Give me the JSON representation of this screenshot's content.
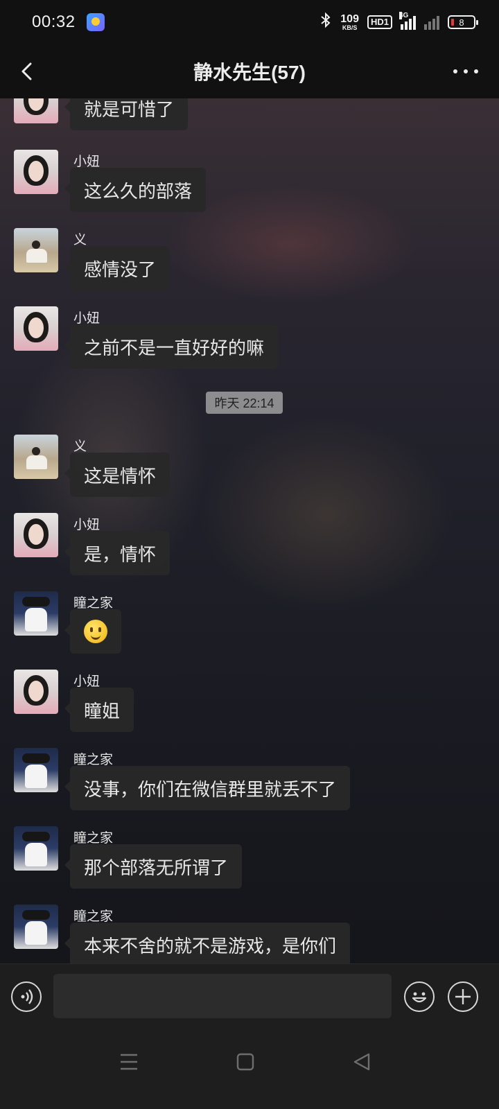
{
  "status_bar": {
    "time": "00:32",
    "speed_value": "109",
    "speed_unit": "KB/S",
    "hd_label": "HD1",
    "network_label": "4G",
    "battery_level": "8",
    "battery_low_color": "#e23b3b",
    "icons": [
      "app-notification-icon",
      "bluetooth-icon",
      "signal-icon",
      "signal-icon",
      "battery-icon"
    ]
  },
  "header": {
    "title": "静水先生(57)",
    "back_icon": "back-chevron-icon",
    "more_icon": "more-dots-icon"
  },
  "messages": [
    {
      "sender": "",
      "avatar": "girl",
      "text": "就是可惜了"
    },
    {
      "sender": "小妞",
      "avatar": "girl",
      "text": "这么久的部落"
    },
    {
      "sender": "义",
      "avatar": "man",
      "text": "感情没了"
    },
    {
      "sender": "小妞",
      "avatar": "girl",
      "text": "之前不是一直好好的嘛"
    },
    {
      "timestamp": "昨天 22:14"
    },
    {
      "sender": "义",
      "avatar": "man",
      "text": "这是情怀"
    },
    {
      "sender": "小妞",
      "avatar": "girl",
      "text": "是，情怀"
    },
    {
      "sender": "瞳之家",
      "avatar": "family",
      "text": "",
      "emoji": "smile-emoji"
    },
    {
      "sender": "小妞",
      "avatar": "girl",
      "text": "瞳姐"
    },
    {
      "sender": "瞳之家",
      "avatar": "family",
      "text": "没事，你们在微信群里就丢不了"
    },
    {
      "sender": "瞳之家",
      "avatar": "family",
      "text": "那个部落无所谓了"
    },
    {
      "sender": "瞳之家",
      "avatar": "family",
      "text": "本来不舍的就不是游戏，是你们"
    }
  ],
  "input_bar": {
    "value": "",
    "placeholder": "",
    "voice_icon": "voice-icon",
    "emoji_icon": "emoji-icon",
    "plus_icon": "plus-icon"
  },
  "nav_bar": {
    "icons": [
      "menu-icon",
      "home-square-icon",
      "back-triangle-icon"
    ]
  }
}
